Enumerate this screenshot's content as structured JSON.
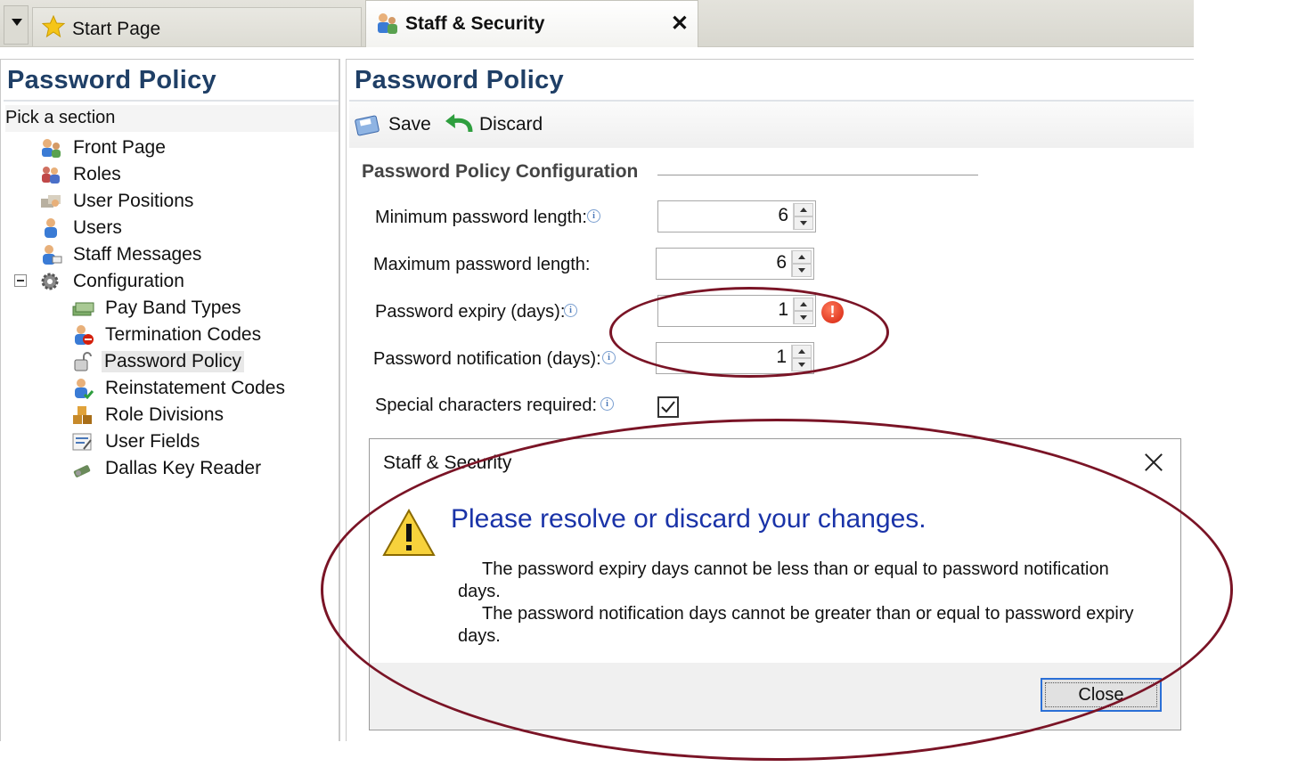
{
  "tabs": {
    "start": {
      "label": "Start Page"
    },
    "staff": {
      "label": "Staff & Security",
      "close": "✕"
    }
  },
  "left": {
    "title": "Password Policy",
    "pick_section": "Pick a section",
    "tree": [
      {
        "label": "Front Page",
        "icon": "front-page-icon"
      },
      {
        "label": "Roles",
        "icon": "roles-icon"
      },
      {
        "label": "User Positions",
        "icon": "user-positions-icon"
      },
      {
        "label": "Users",
        "icon": "users-icon"
      },
      {
        "label": "Staff Messages",
        "icon": "staff-messages-icon"
      },
      {
        "label": "Configuration",
        "icon": "gear-icon"
      },
      {
        "label": "Pay Band Types",
        "icon": "pay-band-icon"
      },
      {
        "label": "Termination Codes",
        "icon": "termination-icon"
      },
      {
        "label": "Password Policy",
        "icon": "lock-icon"
      },
      {
        "label": "Reinstatement Codes",
        "icon": "reinstatement-icon"
      },
      {
        "label": "Role Divisions",
        "icon": "role-divisions-icon"
      },
      {
        "label": "User Fields",
        "icon": "user-fields-icon"
      },
      {
        "label": "Dallas Key Reader",
        "icon": "key-reader-icon"
      }
    ]
  },
  "right": {
    "title": "Password Policy",
    "toolbar": {
      "save": "Save",
      "discard": "Discard"
    },
    "section": "Password Policy Configuration",
    "fields": {
      "min_length": {
        "label": "Minimum password length:",
        "value": "6"
      },
      "max_length": {
        "label": "Maximum password length:",
        "value": "6"
      },
      "expiry": {
        "label": "Password expiry (days):",
        "value": "1"
      },
      "notification": {
        "label": "Password notification (days):",
        "value": "1"
      },
      "special": {
        "label": "Special characters required:",
        "checked": true
      }
    },
    "info_glyph": "i",
    "error_glyph": "!"
  },
  "dialog": {
    "title": "Staff & Security",
    "heading": "Please resolve or discard your changes.",
    "msg1a": "The password expiry days cannot be less than or equal to password notification",
    "msg1b": "days.",
    "msg2a": "The password notification days cannot be greater than or equal to password expiry",
    "msg2b": "days.",
    "close_button": "Close"
  },
  "colors": {
    "title_blue": "#1f3f66",
    "dialog_heading": "#1a33a8",
    "annotation": "#7a1426",
    "error_red": "#d4200c"
  }
}
